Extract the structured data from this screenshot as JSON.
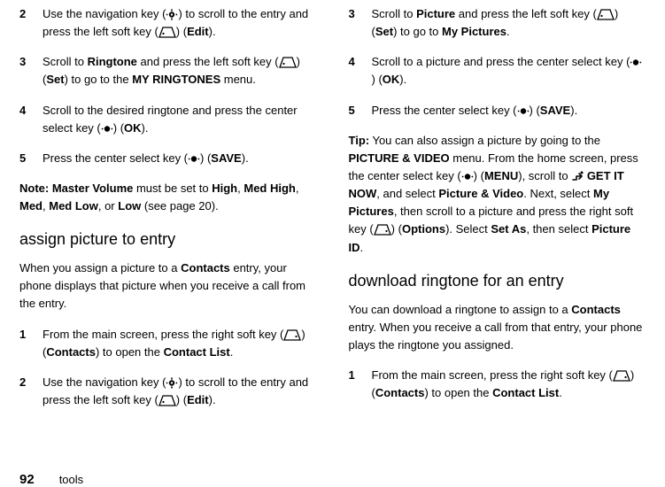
{
  "left": {
    "steps_a": [
      {
        "num": "2",
        "pre": "Use the navigation key (",
        "icon": "nav",
        "mid1": ") to scroll to the entry and press the left soft key (",
        "icon2": "left",
        "mid2": ") (",
        "action": "Edit",
        "post": ")."
      },
      {
        "num": "3",
        "pre": "Scroll to ",
        "scrollTarget": "Ringtone",
        "mid": " and press the left soft key (",
        "icon": "left",
        "mid2": ") (",
        "action": "Set",
        "mid3": ") to go to the ",
        "menu": "MY RINGTONES",
        "post": " menu."
      },
      {
        "num": "4",
        "pre": "Scroll to the desired ringtone and press the center select key (",
        "icon": "center",
        "mid2": ") (",
        "action": "OK",
        "post": ")."
      },
      {
        "num": "5",
        "pre": "Press the center select key (",
        "icon": "center",
        "mid2": ") (",
        "action": "SAVE",
        "post": ")."
      }
    ],
    "note_prefix": "Note: ",
    "note_bold1": "Master Volume",
    "note_mid1": " must be set to ",
    "note_val1": "High",
    "note_sep": ", ",
    "note_val2": "Med High",
    "note_val3": "Med",
    "note_val4": "Med Low",
    "note_or": ", or ",
    "note_val5": "Low",
    "note_post": " (see page 20).",
    "h2": "assign picture to entry",
    "intro_pre": "When you assign a picture to a ",
    "intro_bold": "Contacts",
    "intro_post": " entry, your phone displays that picture when you receive a call from the entry.",
    "steps_b": [
      {
        "num": "1",
        "pre": "From the main screen, press the right soft key (",
        "icon": "right",
        "mid2": ") (",
        "action": "Contacts",
        "mid3": ") to open the ",
        "target": "Contact List",
        "post": "."
      },
      {
        "num": "2",
        "pre": "Use the navigation key (",
        "icon": "nav",
        "mid1": ") to scroll to the entry and press the left soft key (",
        "icon2": "left",
        "mid2": ") (",
        "action": "Edit",
        "post": ")."
      }
    ]
  },
  "right": {
    "steps_a": [
      {
        "num": "3",
        "pre": "Scroll to ",
        "scrollTarget": "Picture",
        "mid": " and press the left soft key (",
        "icon": "left",
        "mid2": ") (",
        "action": "Set",
        "mid3": ") to go to ",
        "target": "My Pictures",
        "post": "."
      },
      {
        "num": "4",
        "pre": "Scroll to a picture and press the center select key (",
        "icon": "center",
        "mid2": ") (",
        "action": "OK",
        "post": ")."
      },
      {
        "num": "5",
        "pre": "Press the center select key (",
        "icon": "center",
        "mid2": ") (",
        "action": "SAVE",
        "post": ")."
      }
    ],
    "tip_prefix": "Tip:",
    "tip_1": " You can also assign a picture by going to the ",
    "tip_menu1": "PICTURE & VIDEO",
    "tip_2": " menu. From the home screen, press the center select key (",
    "tip_3": ") (",
    "tip_action1": "MENU",
    "tip_4": "), scroll to ",
    "tip_dl": " GET IT NOW",
    "tip_5": ", and select ",
    "tip_menu2": "Picture & Video",
    "tip_6": ". Next, select ",
    "tip_menu3": "My Pictures",
    "tip_7": ", then scroll to a picture and press the right soft key (",
    "tip_8": ") (",
    "tip_action2": "Options",
    "tip_9": "). Select ",
    "tip_menu4": "Set As",
    "tip_10": ", then select ",
    "tip_menu5": "Picture ID",
    "tip_11": ".",
    "h2": "download ringtone for an entry",
    "dl_pre": "You can download a ringtone to assign to a ",
    "dl_bold": "Contacts",
    "dl_post": " entry. When you receive a call from that entry, your phone plays the ringtone you assigned.",
    "steps_b": [
      {
        "num": "1",
        "pre": "From the main screen, press the right soft key (",
        "icon": "right",
        "mid2": ") (",
        "action": "Contacts",
        "mid3": ") to open the ",
        "target": "Contact List",
        "post": "."
      }
    ]
  },
  "footer": {
    "page": "92",
    "section": "tools"
  }
}
